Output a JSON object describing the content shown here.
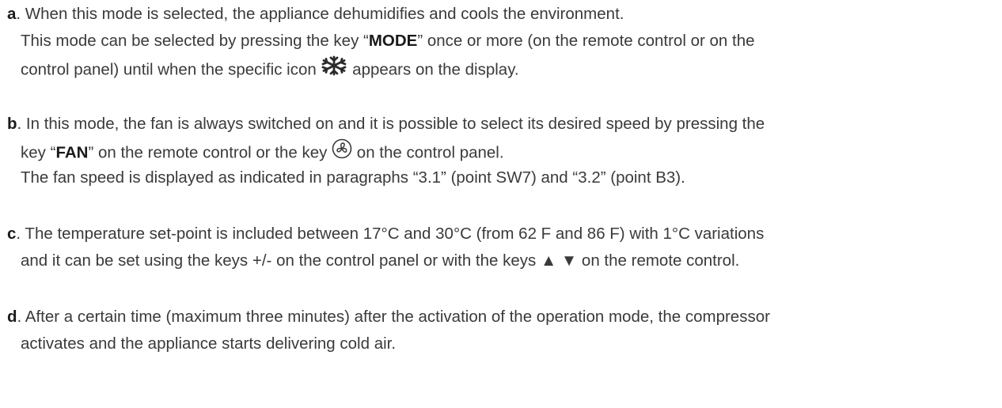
{
  "items": {
    "a": {
      "letter": "a",
      "line1": ". When this mode is selected, the appliance dehumidifies and cools the environment.",
      "line2_pre": "This mode can be selected by pressing the key “",
      "line2_key": "MODE",
      "line2_post": "” once or more (on the remote control or on the",
      "line3_pre": "control panel) until when the specific icon ",
      "line3_post": " appears on the display."
    },
    "b": {
      "letter": "b",
      "line1": ". In this mode, the fan is always  switched on and it is possible to select its desired speed by pressing the",
      "line2_pre": "key “",
      "line2_key": "FAN",
      "line2_mid": "” on the remote control or the key ",
      "line2_post": " on the control panel.",
      "line3": "The fan speed is displayed as indicated in paragraphs “3.1” (point SW7) and “3.2” (point B3)."
    },
    "c": {
      "letter": "c",
      "line1": ". The temperature set-point is included between 17°C and 30°C (from 62 F and 86 F) with 1°C variations",
      "line2": "and it can be set using the keys +/- on the control panel or with the keys ▲ ▼ on the remote control."
    },
    "d": {
      "letter": "d",
      "line1": ". After a certain time (maximum three minutes) after the activation of the operation mode, the compressor",
      "line2": "activates and the appliance starts delivering cold air."
    }
  },
  "icons": {
    "cool_mode": "snowflake-icon",
    "fan_key": "fan-icon"
  }
}
